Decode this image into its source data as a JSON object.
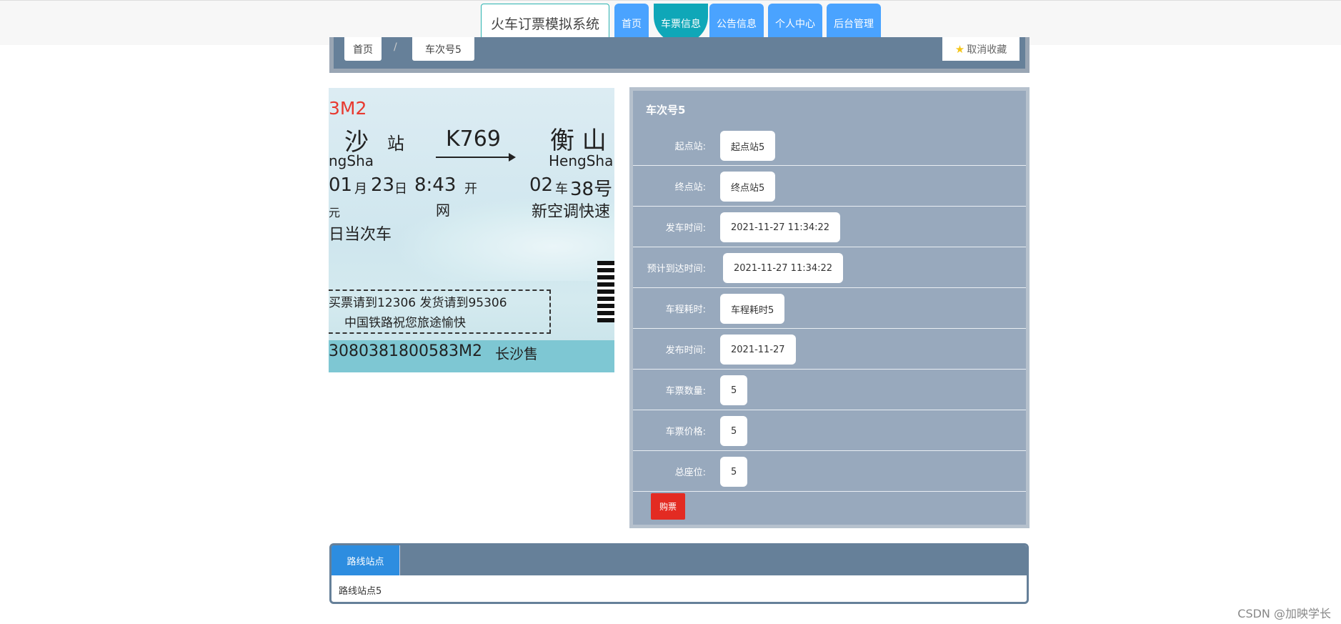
{
  "navbar": {
    "brand": "火车订票模拟系统",
    "items": [
      {
        "label": "首页"
      },
      {
        "label": "车票信息"
      },
      {
        "label": "公告信息"
      },
      {
        "label": "个人中心"
      },
      {
        "label": "后台管理"
      }
    ],
    "active_index": 1
  },
  "breadcrumb": {
    "home": "首页",
    "separator": "/",
    "current": "车次号5",
    "favorite_label": "取消收藏"
  },
  "ticket_image": {
    "code_top": "3M2",
    "from_station": "沙",
    "station_char": "站",
    "train_no": "K769",
    "to_station": "衡 山",
    "from_pinyin": "ngSha",
    "to_pinyin": "HengShan",
    "date_month": "01",
    "month_char": "月",
    "date_day": "23",
    "day_char": "日",
    "time": "8:43",
    "kai": "开",
    "car": "02",
    "car_char": "车",
    "seat": "38号",
    "price_suffix": "元",
    "wang": "网",
    "class": "新空调快速",
    "valid": "日当次车",
    "notice1": "买票请到12306  发货请到95306",
    "notice2": "中国铁路祝您旅途愉快",
    "serial": "3080381800583M2",
    "sold_at": "长沙售"
  },
  "detail": {
    "title": "车次号5",
    "fields": [
      {
        "label": "起点站:",
        "value": "起点站5"
      },
      {
        "label": "终点站:",
        "value": "终点站5"
      },
      {
        "label": "发车时间:",
        "value": "2021-11-27 11:34:22"
      },
      {
        "label": "预计到达时间:",
        "value": "2021-11-27 11:34:22"
      },
      {
        "label": "车程耗时:",
        "value": "车程耗时5"
      },
      {
        "label": "发布时间:",
        "value": "2021-11-27"
      },
      {
        "label": "车票数量:",
        "value": "5"
      },
      {
        "label": "车票价格:",
        "value": "5"
      },
      {
        "label": "总座位:",
        "value": "5"
      }
    ],
    "buy_label": "购票"
  },
  "route": {
    "tab_label": "路线站点",
    "content": "路线站点5"
  },
  "watermark": "CSDN @加映学长",
  "colors": {
    "nav_button": "#4aa3ff",
    "nav_active": "#0fa7b8",
    "panel": "#98a9bd",
    "header_strip": "#668099",
    "buy_button": "#e32b22",
    "route_tab": "#2d8de0"
  }
}
